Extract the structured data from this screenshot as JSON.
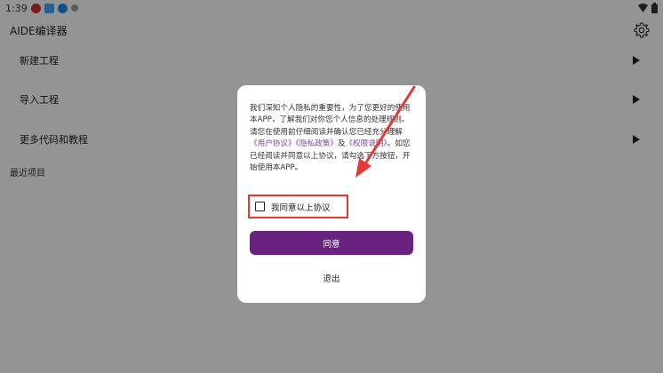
{
  "status_bar": {
    "time": "1:39"
  },
  "app": {
    "title": "AIDE编译器"
  },
  "menu": {
    "items": [
      {
        "label": "新建工程"
      },
      {
        "label": "导入工程"
      },
      {
        "label": "更多代码和教程"
      }
    ],
    "recent_title": "最近项目"
  },
  "dialog": {
    "text_1": "我们深知个人隐私的重要性，为了您更好的使用本APP，了解我们对你您个人信息的处理规则。请您在使用前仔细阅读并确认您已经充分理解",
    "link_user_agreement": "《用户协议》",
    "link_privacy_policy": "《隐私政策》",
    "text_and": "及",
    "link_permission": "《权限说明》",
    "text_2": "。如您已经阅读并同意以上协议，请勾选下方按钮，开始使用本APP。",
    "checkbox_label": "我同意以上协议",
    "agree_button": "同意",
    "exit_button": "退出"
  },
  "colors": {
    "accent": "#6a2281",
    "link": "#7b3fa0",
    "highlight": "#e53935"
  }
}
